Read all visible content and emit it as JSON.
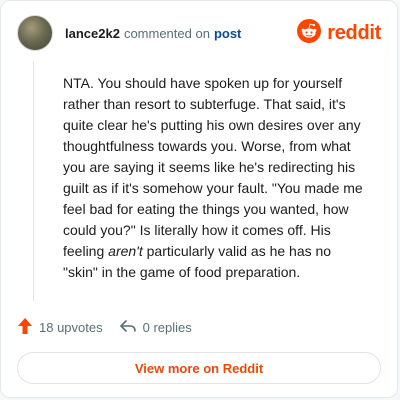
{
  "header": {
    "username": "lance2k2",
    "action_text": "commented on",
    "target_link": "post",
    "brand_name": "reddit"
  },
  "comment": {
    "text_part1": "NTA. You should have spoken up for yourself rather than resort to subterfuge. That said, it's quite clear he's putting his own desires over any thoughtfulness towards you. Worse, from what you are saying it seems like he's redirecting his guilt as if it's somehow your fault. \"You made me feel bad for eating the things you wanted, how could you?\" Is literally how it comes off. His feeling ",
    "text_italic": "aren't",
    "text_part2": " particularly valid as he has no \"skin\" in the game of food preparation."
  },
  "actions": {
    "upvotes_label": "18 upvotes",
    "replies_label": "0 replies"
  },
  "footer": {
    "view_more_label": "View more on Reddit"
  },
  "colors": {
    "brand": "#ff4500",
    "link": "#0b4c9a",
    "muted": "#576f76"
  },
  "icons": {
    "avatar": "avatar",
    "logo": "reddit-logo-icon",
    "upvote": "upvote-arrow-icon",
    "reply": "reply-arrow-icon"
  }
}
